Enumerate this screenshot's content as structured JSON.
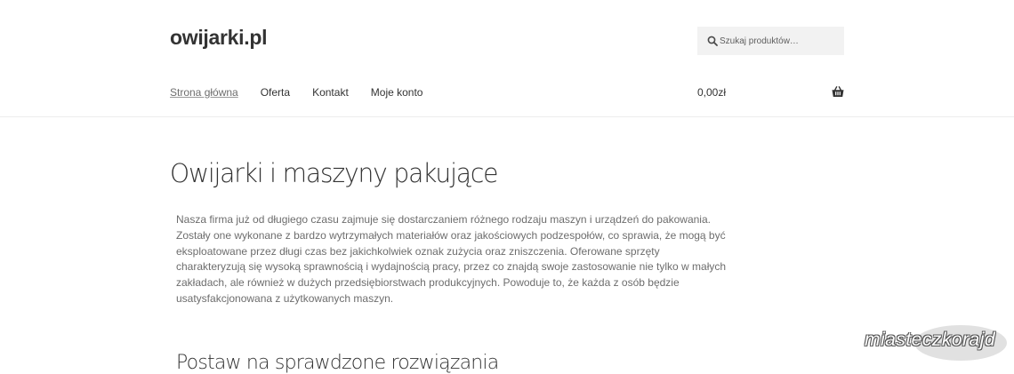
{
  "header": {
    "site_title": "owijarki.pl",
    "search_placeholder": "Szukaj produktów…",
    "icons": {
      "search": "search-icon",
      "cart": "basket-icon"
    }
  },
  "nav": {
    "items": [
      {
        "label": "Strona główna",
        "current": true
      },
      {
        "label": "Oferta"
      },
      {
        "label": "Kontakt"
      },
      {
        "label": "Moje konto"
      }
    ]
  },
  "cart": {
    "total": "0,00zł"
  },
  "main": {
    "title": "Owijarki i maszyny pakujące",
    "intro": "Nasza firma już od długiego czasu zajmuje się dostarczaniem różnego rodzaju maszyn i urządzeń do pakowania. Zostały one wykonane z bardzo wytrzymałych materiałów oraz jakościowych podzespołów, co sprawia, że mogą być eksploatowane przez długi czas bez jakichkolwiek oznak zużycia oraz zniszczenia. Oferowane sprzęty charakteryzują się wysoką sprawnością i wydajnością pracy, przez co znajdą swoje zastosowanie nie tylko w małych zakładach, ale również w dużych przedsiębiorstwach produkcyjnych. Powoduje to, że każda z osób będzie usatysfakcjonowana z użytkowanych maszyn.",
    "section_heading": "Postaw na sprawdzone rozwiązania"
  },
  "watermark": {
    "text": "miasteczkorajd"
  },
  "colors": {
    "text": "#333333",
    "muted": "#6d6d6d",
    "search_bg": "#f2f2f2"
  }
}
